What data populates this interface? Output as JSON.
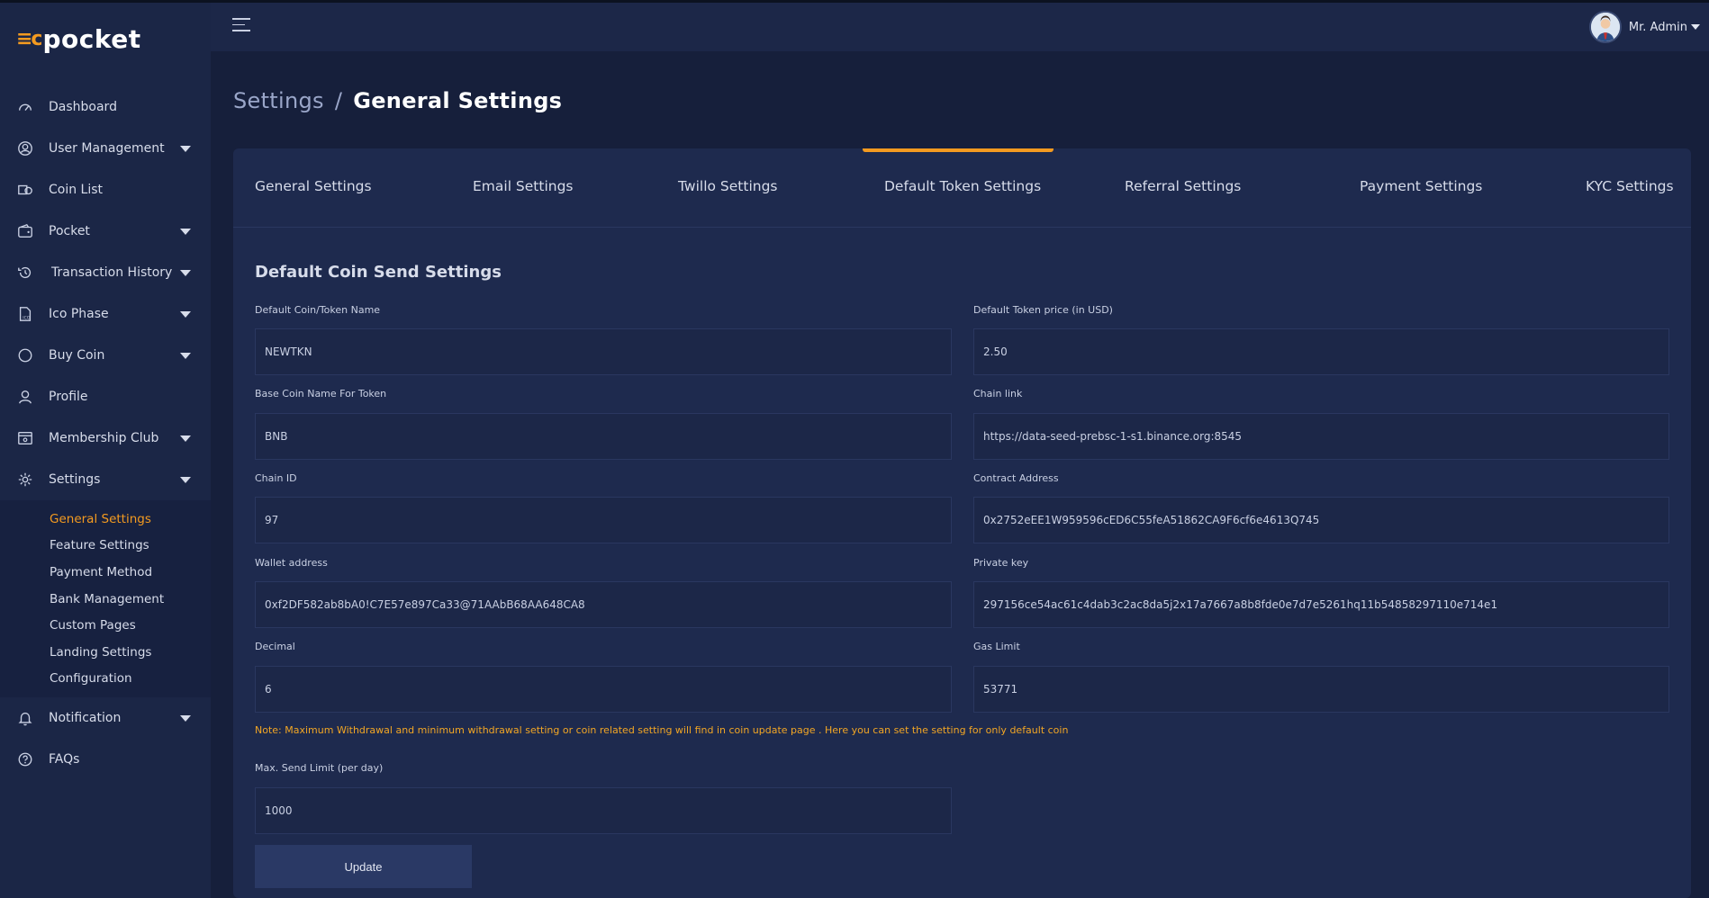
{
  "brand": {
    "mark": "≡c",
    "name": "pocket"
  },
  "sidebar": {
    "items": [
      {
        "label": "Dashboard",
        "icon": "dashboard-gauge-icon",
        "caret": false
      },
      {
        "label": "User Management",
        "icon": "user-circle-icon",
        "caret": true
      },
      {
        "label": "Coin List",
        "icon": "coin-stack-icon",
        "caret": false
      },
      {
        "label": "Pocket",
        "icon": "wallet-icon",
        "caret": true
      },
      {
        "label": "Transaction History",
        "icon": "history-icon",
        "caret": true
      },
      {
        "label": "Ico Phase",
        "icon": "ico-document-icon",
        "caret": true
      },
      {
        "label": "Buy Coin",
        "icon": "circle-icon",
        "caret": true
      },
      {
        "label": "Profile",
        "icon": "person-icon",
        "caret": false
      },
      {
        "label": "Membership Club",
        "icon": "membership-card-icon",
        "caret": true
      },
      {
        "label": "Settings",
        "icon": "gear-icon",
        "caret": true
      }
    ],
    "settings_sub": [
      {
        "label": "General Settings",
        "active": true
      },
      {
        "label": "Feature Settings",
        "active": false
      },
      {
        "label": "Payment Method",
        "active": false
      },
      {
        "label": "Bank Management",
        "active": false
      },
      {
        "label": "Custom Pages",
        "active": false
      },
      {
        "label": "Landing Settings",
        "active": false
      },
      {
        "label": "Configuration",
        "active": false
      }
    ],
    "bottom_items": [
      {
        "label": "Notification",
        "icon": "bell-icon",
        "caret": true
      },
      {
        "label": "FAQs",
        "icon": "question-circle-icon",
        "caret": false
      }
    ]
  },
  "topbar": {
    "user_name": "Mr. Admin"
  },
  "breadcrumb": {
    "parent": "Settings",
    "separator": "/",
    "current": "General Settings"
  },
  "tabs": [
    {
      "label": "General Settings"
    },
    {
      "label": "Email Settings"
    },
    {
      "label": "Twillo Settings"
    },
    {
      "label": "Default Token Settings",
      "active": true
    },
    {
      "label": "Referral Settings"
    },
    {
      "label": "Payment Settings"
    },
    {
      "label": "KYC Settings"
    }
  ],
  "form": {
    "title": "Default Coin Send Settings",
    "fields": {
      "coin_name": {
        "label": "Default Coin/Token Name",
        "value": "NEWTKN"
      },
      "token_price": {
        "label": "Default Token price (in USD)",
        "value": "2.50"
      },
      "base_coin": {
        "label": "Base Coin Name For Token",
        "value": "BNB"
      },
      "chain_link": {
        "label": "Chain link",
        "value": "https://data-seed-prebsc-1-s1.binance.org:8545"
      },
      "chain_id": {
        "label": "Chain ID",
        "value": "97"
      },
      "contract_address": {
        "label": "Contract Address",
        "value": "0x2752eEE1W959596cED6C55feA51862CA9F6cf6e4613Q745"
      },
      "wallet_address": {
        "label": "Wallet address",
        "value": "0xf2DF582ab8bA0!C7E57e897Ca33@71AAbB68AA648CA8"
      },
      "private_key": {
        "label": "Private key",
        "value": "297156ce54ac61c4dab3c2ac8da5j2x17a7667a8b8fde0e7d7e5261hq11b54858297110e714e1"
      },
      "decimal": {
        "label": "Decimal",
        "value": "6"
      },
      "gas_limit": {
        "label": "Gas Limit",
        "value": "53771"
      },
      "max_send": {
        "label": "Max. Send Limit (per day)",
        "value": "1000"
      }
    },
    "note": "Note: Maximum Withdrawal and minimum withdrawal setting or coin related setting will find in coin update page . Here you can set the setting for only default coin",
    "update_label": "Update"
  },
  "colors": {
    "accent": "#f39a20",
    "sidebar": "#1b2646",
    "content": "#161f3b",
    "card": "#1e2a4e"
  }
}
